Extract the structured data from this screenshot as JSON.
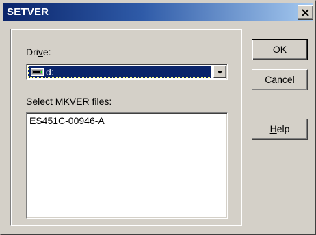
{
  "window": {
    "title": "SETVER",
    "close_glyph": "×"
  },
  "drive": {
    "label_prefix": "Dri",
    "label_mnemonic": "v",
    "label_suffix": "e:",
    "selected_value": "d:",
    "drive_icon": "drive-icon",
    "dropdown_icon": "chevron-down-icon"
  },
  "files": {
    "label_mnemonic": "S",
    "label_rest": "elect MKVER files:",
    "items": [
      "ES451C-00946-A"
    ]
  },
  "buttons": {
    "ok": "OK",
    "cancel": "Cancel",
    "help_mnemonic": "H",
    "help_rest": "elp"
  },
  "colors": {
    "face": "#d4d0c8",
    "title_start": "#0a246a",
    "title_end": "#a6caf0",
    "selection": "#0a246a"
  }
}
